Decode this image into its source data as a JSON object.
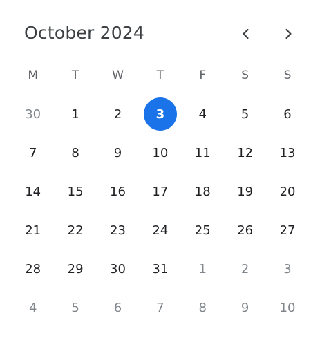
{
  "header": {
    "title": "October 2024",
    "prev_icon": "chevron-left-icon",
    "next_icon": "chevron-right-icon"
  },
  "colors": {
    "text": "#202124",
    "muted": "#80868b",
    "weekday": "#5f6368",
    "accent": "#1a73e8",
    "selected_text": "#ffffff"
  },
  "weekdays": [
    "M",
    "T",
    "W",
    "T",
    "F",
    "S",
    "S"
  ],
  "selected_day": "3",
  "weeks": [
    [
      {
        "label": "30",
        "outside": true
      },
      {
        "label": "1",
        "outside": false
      },
      {
        "label": "2",
        "outside": false
      },
      {
        "label": "3",
        "outside": false,
        "selected": true
      },
      {
        "label": "4",
        "outside": false
      },
      {
        "label": "5",
        "outside": false
      },
      {
        "label": "6",
        "outside": false
      }
    ],
    [
      {
        "label": "7",
        "outside": false
      },
      {
        "label": "8",
        "outside": false
      },
      {
        "label": "9",
        "outside": false
      },
      {
        "label": "10",
        "outside": false
      },
      {
        "label": "11",
        "outside": false
      },
      {
        "label": "12",
        "outside": false
      },
      {
        "label": "13",
        "outside": false
      }
    ],
    [
      {
        "label": "14",
        "outside": false
      },
      {
        "label": "15",
        "outside": false
      },
      {
        "label": "16",
        "outside": false
      },
      {
        "label": "17",
        "outside": false
      },
      {
        "label": "18",
        "outside": false
      },
      {
        "label": "19",
        "outside": false
      },
      {
        "label": "20",
        "outside": false
      }
    ],
    [
      {
        "label": "21",
        "outside": false
      },
      {
        "label": "22",
        "outside": false
      },
      {
        "label": "23",
        "outside": false
      },
      {
        "label": "24",
        "outside": false
      },
      {
        "label": "25",
        "outside": false
      },
      {
        "label": "26",
        "outside": false
      },
      {
        "label": "27",
        "outside": false
      }
    ],
    [
      {
        "label": "28",
        "outside": false
      },
      {
        "label": "29",
        "outside": false
      },
      {
        "label": "30",
        "outside": false
      },
      {
        "label": "31",
        "outside": false
      },
      {
        "label": "1",
        "outside": true
      },
      {
        "label": "2",
        "outside": true
      },
      {
        "label": "3",
        "outside": true
      }
    ],
    [
      {
        "label": "4",
        "outside": true
      },
      {
        "label": "5",
        "outside": true
      },
      {
        "label": "6",
        "outside": true
      },
      {
        "label": "7",
        "outside": true
      },
      {
        "label": "8",
        "outside": true
      },
      {
        "label": "9",
        "outside": true
      },
      {
        "label": "10",
        "outside": true
      }
    ]
  ]
}
